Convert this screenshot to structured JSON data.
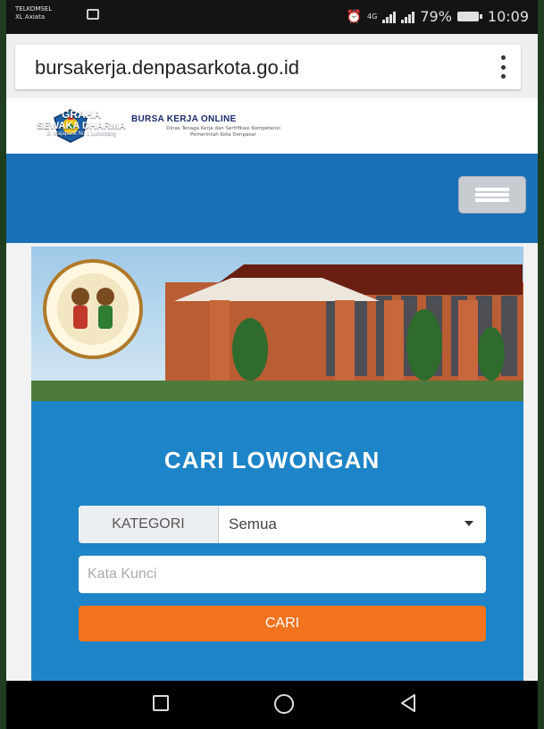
{
  "statusbar": {
    "carrier_line1": "TELKOMSEL",
    "carrier_line2": "XL Axiata",
    "network_badge": "4G",
    "battery": "79%",
    "time": "10:09"
  },
  "browser": {
    "url": "bursakerja.denpasarkota.go.id",
    "menu_icon": "more-vert-icon"
  },
  "header": {
    "title": "BURSA KERJA ONLINE",
    "subtitle_line1": "Dinas Tenaga Kerja dan Sertifikasi Kompetensi",
    "subtitle_line2": "Pemerintah Kota Denpasar"
  },
  "nav": {
    "menu_icon": "hamburger-icon"
  },
  "banner": {
    "line1": "GRAHA",
    "line2": "SEWAKA DHARMA",
    "line3": "Jl. Majapahit No 1 Lumintang"
  },
  "search": {
    "title": "CARI LOWONGAN",
    "category_label": "KATEGORI",
    "category_value": "Semua",
    "keyword_placeholder": "Kata Kunci",
    "submit_label": "CARI"
  },
  "colors": {
    "nav_blue": "#1a70b6",
    "panel_blue": "#1e84c8",
    "button_orange": "#f3731e"
  }
}
